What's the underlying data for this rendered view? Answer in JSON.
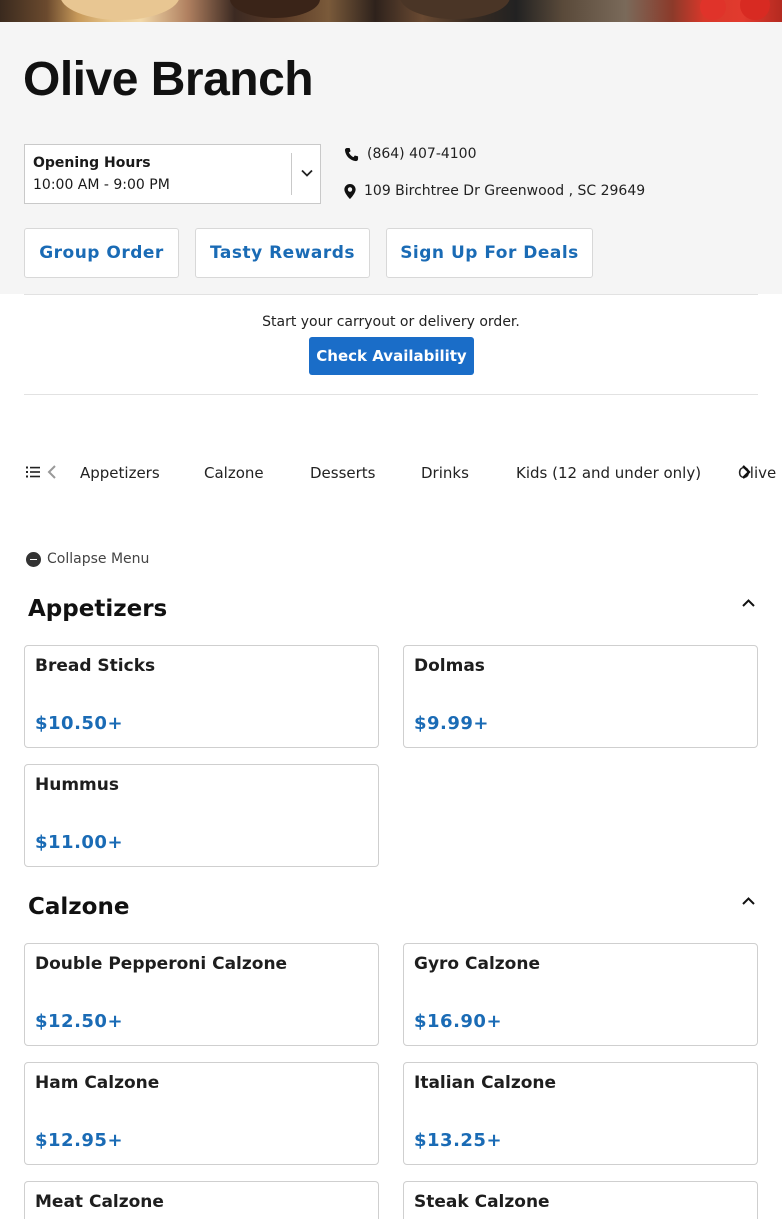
{
  "restaurant": {
    "name": "Olive Branch",
    "opening_hours_label": "Opening Hours",
    "opening_hours_value": "10:00 AM - 9:00 PM",
    "phone": "(864) 407-4100",
    "address": "109 Birchtree Dr Greenwood , SC 29649"
  },
  "actions": {
    "group_order": "Group Order",
    "tasty_rewards": "Tasty Rewards",
    "sign_up": "Sign Up For Deals"
  },
  "availability": {
    "text": "Start your carryout or delivery order.",
    "button": "Check Availability"
  },
  "categories": [
    "Appetizers",
    "Calzone",
    "Desserts",
    "Drinks",
    "Kids (12 and under only)",
    "Olive B"
  ],
  "collapse_label": "Collapse Menu",
  "sections": [
    {
      "title": "Appetizers",
      "items": [
        {
          "name": "Bread Sticks",
          "price": "$10.50+"
        },
        {
          "name": "Dolmas",
          "price": "$9.99+"
        },
        {
          "name": "Hummus",
          "price": "$11.00+"
        }
      ]
    },
    {
      "title": "Calzone",
      "items": [
        {
          "name": "Double Pepperoni Calzone",
          "price": "$12.50+"
        },
        {
          "name": "Gyro Calzone",
          "price": "$16.90+"
        },
        {
          "name": "Ham Calzone",
          "price": "$12.95+"
        },
        {
          "name": "Italian Calzone",
          "price": "$13.25+"
        },
        {
          "name": "Meat Calzone",
          "price": ""
        },
        {
          "name": "Steak Calzone",
          "price": ""
        }
      ]
    }
  ],
  "colors": {
    "accent": "#1a6bb5",
    "button": "#1a6dc8",
    "header_bg": "#f5f5f5"
  }
}
